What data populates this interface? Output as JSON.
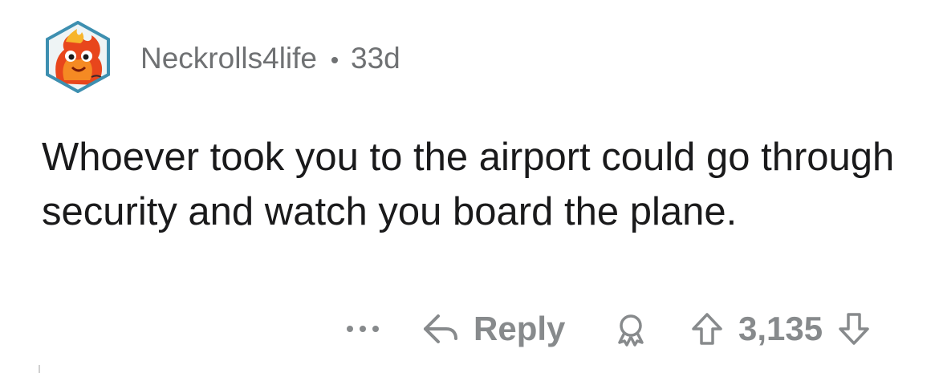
{
  "comment": {
    "username": "Neckrolls4life",
    "age": "33d",
    "body": "Whoever took you to the airport could go through security and watch you board the plane.",
    "avatar_icon": "fire-mascot-avatar-icon"
  },
  "actions": {
    "more_icon": "ellipsis-icon",
    "reply_icon": "reply-arrow-icon",
    "reply_label": "Reply",
    "award_icon": "award-icon",
    "upvote_icon": "upvote-arrow-icon",
    "score": "3,135",
    "downvote_icon": "downvote-arrow-icon"
  },
  "colors": {
    "text": "#1a1a1b",
    "meta": "#6f7173",
    "action": "#878a8c",
    "avatar_border": "#4aa8c9"
  }
}
